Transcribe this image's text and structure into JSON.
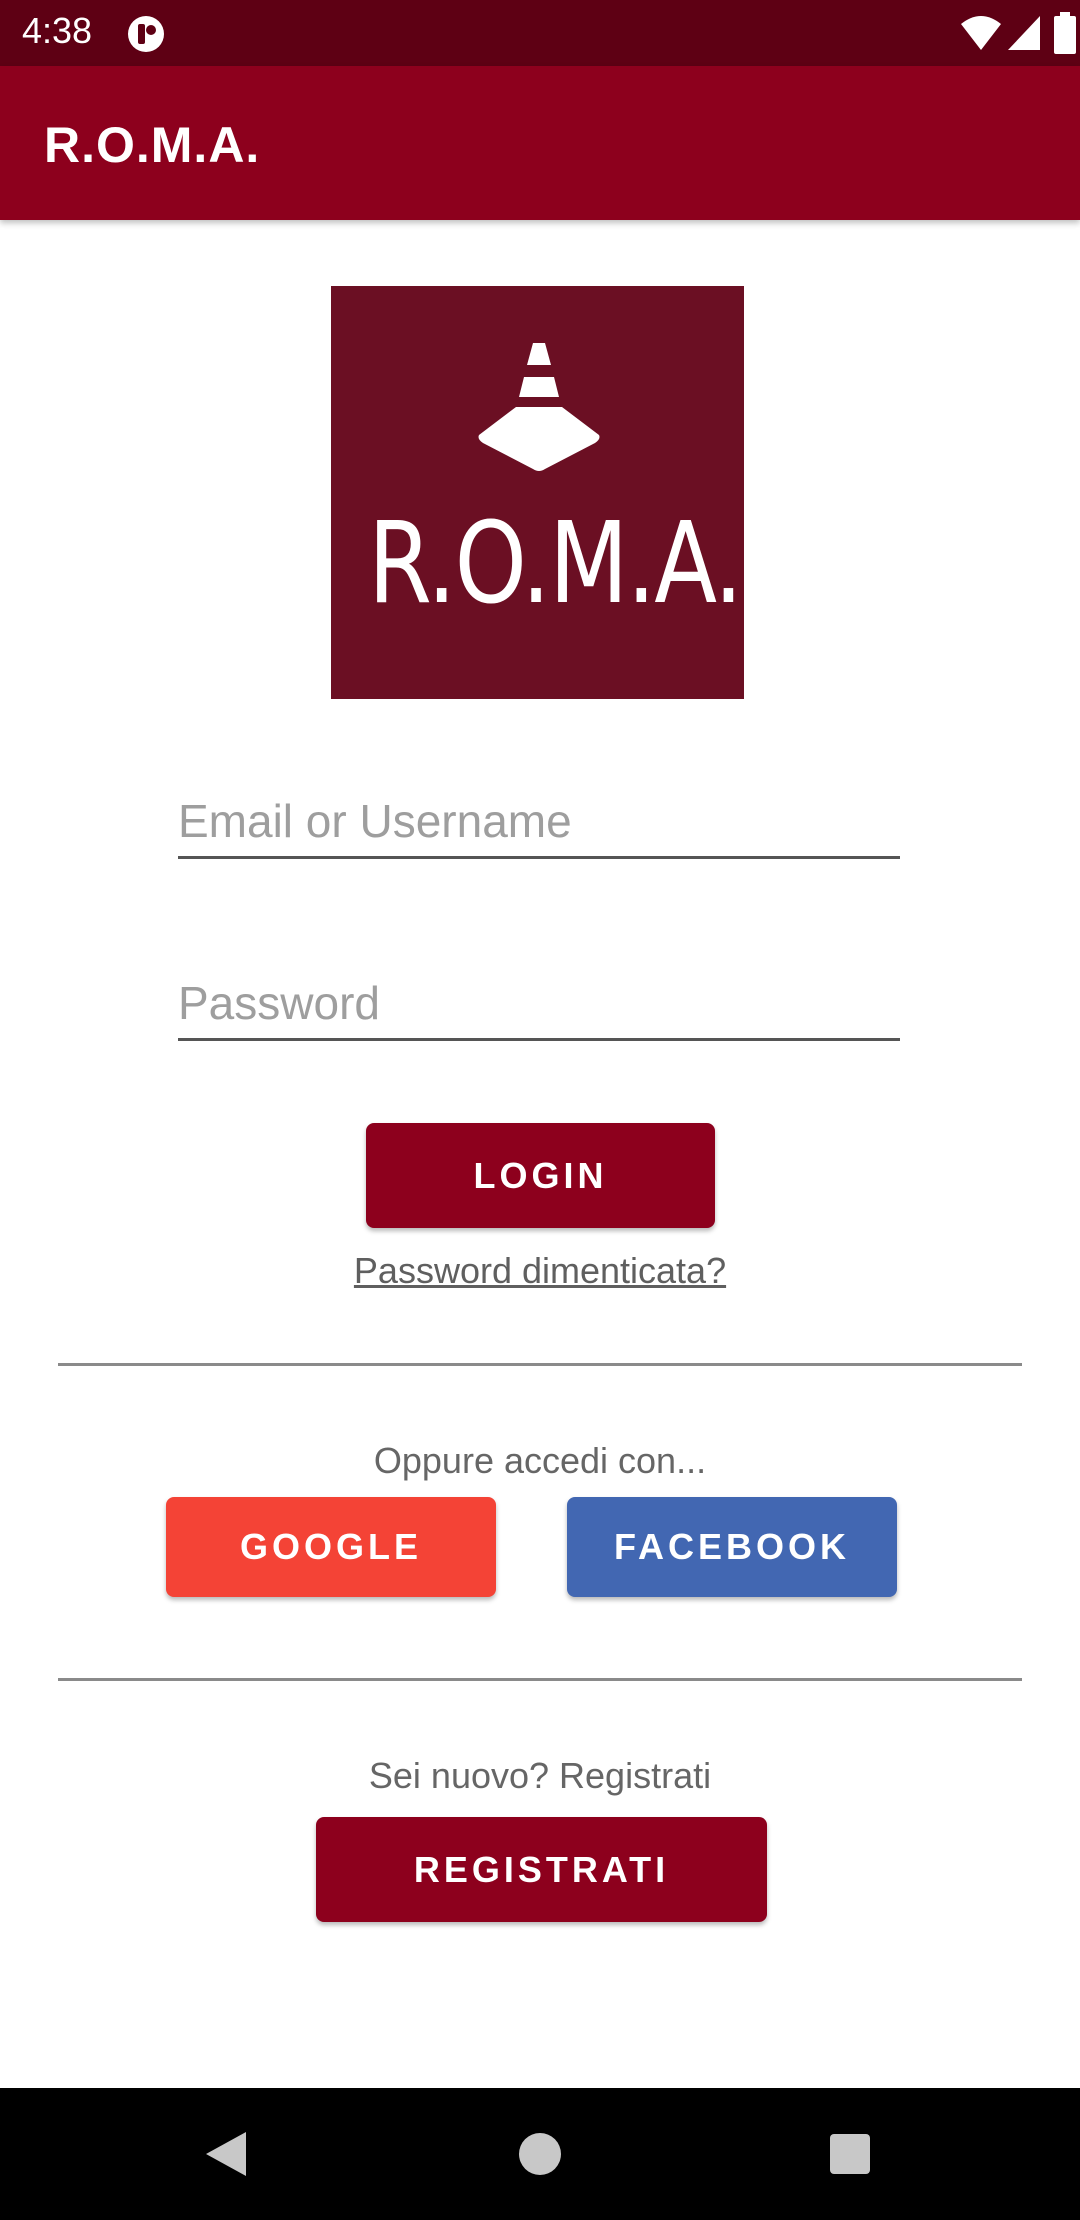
{
  "status_bar": {
    "time": "4:38",
    "icons": [
      "app-notification-icon",
      "wifi-icon",
      "signal-icon",
      "battery-icon"
    ]
  },
  "app_bar": {
    "title": "R.O.M.A."
  },
  "logo": {
    "text": "R.O.M.A.",
    "icon": "traffic-cone-icon",
    "background": "#6b0f23"
  },
  "login_form": {
    "email_placeholder": "Email or Username",
    "password_placeholder": "Password",
    "login_label": "LOGIN",
    "forgot_label": "Password dimenticata?"
  },
  "social_login": {
    "caption": "Oppure accedi con...",
    "google_label": "GOOGLE",
    "facebook_label": "FACEBOOK"
  },
  "register": {
    "caption": "Sei nuovo? Registrati",
    "button_label": "REGISTRATI"
  },
  "nav_bar": {
    "icons": [
      "back-icon",
      "home-icon",
      "recents-icon"
    ]
  },
  "colors": {
    "primary": "#8d001d",
    "status_bar": "#5e0014",
    "google": "#f44336",
    "facebook": "#4267b2"
  }
}
